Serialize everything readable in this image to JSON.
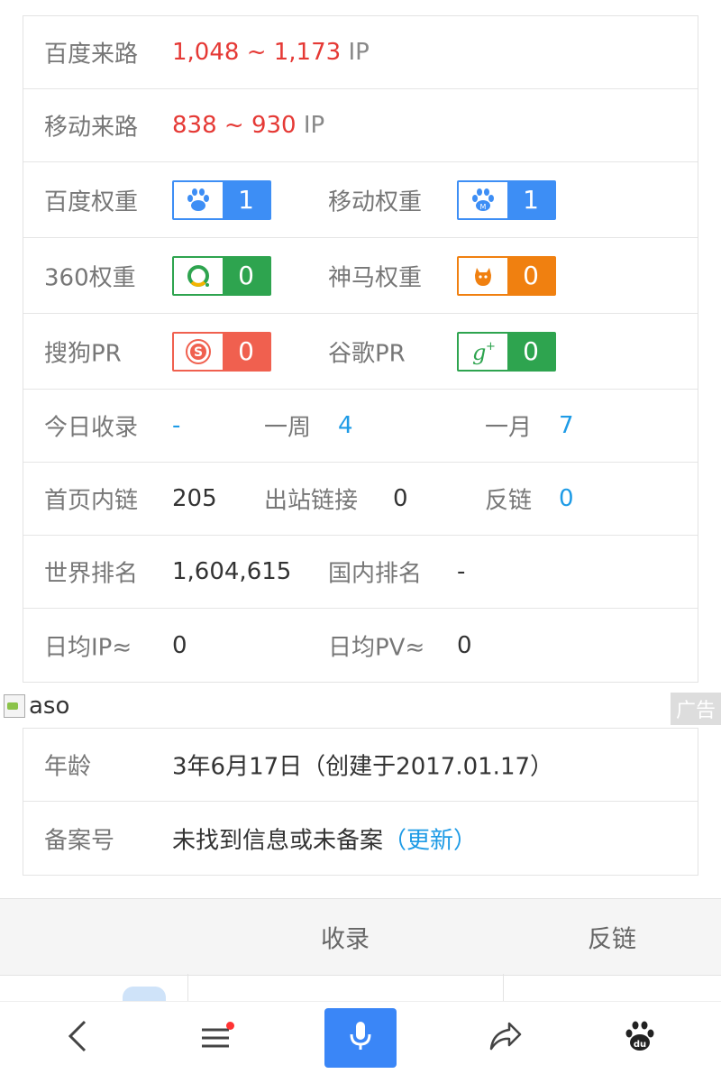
{
  "traffic": {
    "baidu_label": "百度来路",
    "baidu_value": "1,048 ~ 1,173",
    "mobile_label": "移动来路",
    "mobile_value": "838 ~ 930",
    "unit": "IP"
  },
  "weights": {
    "baidu_label": "百度权重",
    "baidu_value": "1",
    "mobile_label": "移动权重",
    "mobile_value": "1",
    "s360_label": "360权重",
    "s360_value": "0",
    "shenma_label": "神马权重",
    "shenma_value": "0",
    "sogou_label": "搜狗PR",
    "sogou_value": "0",
    "google_label": "谷歌PR",
    "google_value": "0"
  },
  "index": {
    "today_label": "今日收录",
    "today_value": "-",
    "week_label": "一周",
    "week_value": "4",
    "month_label": "一月",
    "month_value": "7"
  },
  "links": {
    "internal_label": "首页内链",
    "internal_value": "205",
    "outbound_label": "出站链接",
    "outbound_value": "0",
    "backlink_label": "反链",
    "backlink_value": "0"
  },
  "rank": {
    "world_label": "世界排名",
    "world_value": "1,604,615",
    "domestic_label": "国内排名",
    "domestic_value": "-"
  },
  "daily": {
    "ip_label": "日均IP≈",
    "ip_value": "0",
    "pv_label": "日均PV≈",
    "pv_value": "0"
  },
  "ad": {
    "alt_text": "aso",
    "tag": "广告"
  },
  "domain_info": {
    "age_label": "年龄",
    "age_value": "3年6月17日（创建于2017.01.17）",
    "icp_label": "备案号",
    "icp_value": "未找到信息或未备案",
    "icp_update": "（更新）"
  },
  "tabs": [
    "收录",
    "反链"
  ],
  "colors": {
    "red": "#e53935",
    "blue": "#1e9be6",
    "accent": "#3a86f7"
  }
}
